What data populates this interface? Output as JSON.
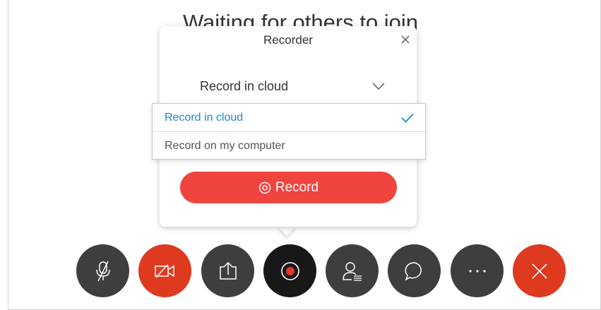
{
  "meeting": {
    "status_text": "Waiting for others to join"
  },
  "recorder": {
    "title": "Recorder",
    "selected_option": "Record in cloud",
    "options": [
      {
        "label": "Record in cloud",
        "selected": true
      },
      {
        "label": "Record on my computer",
        "selected": false
      }
    ],
    "record_button_label": "Record"
  },
  "controls": [
    {
      "name": "mute",
      "icon": "mic-muted-icon",
      "color": "#3e3e3e"
    },
    {
      "name": "video",
      "icon": "video-off-icon",
      "color": "#dd3a20"
    },
    {
      "name": "share",
      "icon": "share-icon",
      "color": "#3e3e3e"
    },
    {
      "name": "record",
      "icon": "record-icon",
      "color": "#181818"
    },
    {
      "name": "participants",
      "icon": "participants-icon",
      "color": "#3e3e3e"
    },
    {
      "name": "chat",
      "icon": "chat-icon",
      "color": "#3e3e3e"
    },
    {
      "name": "more",
      "icon": "more-icon",
      "color": "#3e3e3e"
    },
    {
      "name": "leave",
      "icon": "close-icon",
      "color": "#dd3a20"
    }
  ],
  "colors": {
    "accent_blue": "#1d8bc0",
    "record_red": "#f0443f",
    "danger_red": "#dd3a20",
    "control_dark": "#3e3e3e"
  }
}
